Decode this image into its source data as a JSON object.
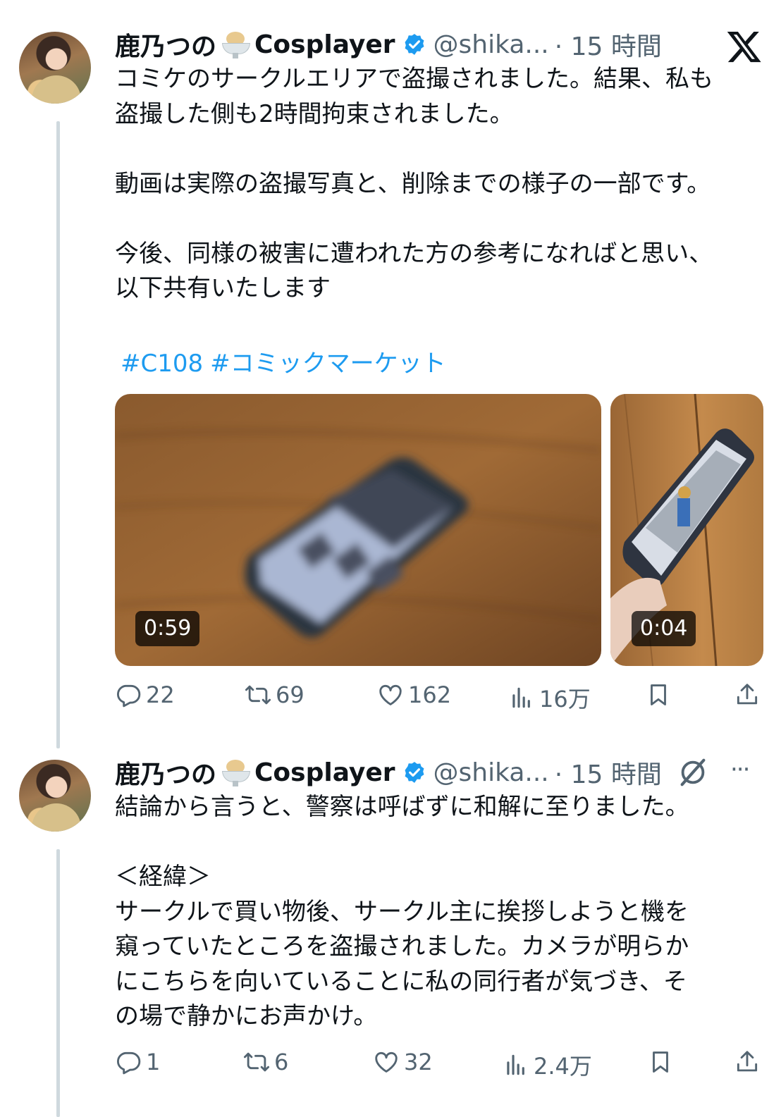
{
  "tweets": [
    {
      "author_name": "鹿乃つの",
      "author_suffix": "Cosplayer",
      "handle": "@shika...",
      "time": "· 15 時間",
      "text_lines": [
        "コミケのサークルエリアで盗撮されました。結果、私も\n盗撮した側も2時間拘束されました。",
        "動画は実際の盗撮写真と、削除までの様子の一部です。",
        "今後、同様の被害に遭われた方の参考になればと思い、\n以下共有いたします"
      ],
      "hashtags": [
        "#C108",
        "#コミックマーケット"
      ],
      "media": [
        {
          "duration": "0:59"
        },
        {
          "duration": "0:04"
        }
      ],
      "replies": "22",
      "reposts": "69",
      "likes": "162",
      "views": "16万"
    },
    {
      "author_name": "鹿乃つの",
      "author_suffix": "Cosplayer",
      "handle": "@shika...",
      "time": "· 15 時間",
      "more": "···",
      "text_lines": [
        "結論から言うと、警察は呼ばずに和解に至りました。",
        "＜経緯＞\nサークルで買い物後、サークル主に挨拶しようと機を\n窺っていたところを盗撮されました。カメラが明らか\nにこちらを向いていることに私の同行者が気づき、そ\nの場で静かにお声かけ。"
      ],
      "replies": "1",
      "reposts": "6",
      "likes": "32",
      "views": "2.4万"
    }
  ],
  "colors": {
    "link": "#1d9bf0",
    "muted": "#536471",
    "verified": "#1d9bf0"
  },
  "icons": [
    "x-logo-icon",
    "verified-badge-icon",
    "reply-icon",
    "repost-icon",
    "like-icon",
    "views-icon",
    "bookmark-icon",
    "share-icon",
    "grok-icon",
    "more-icon"
  ]
}
